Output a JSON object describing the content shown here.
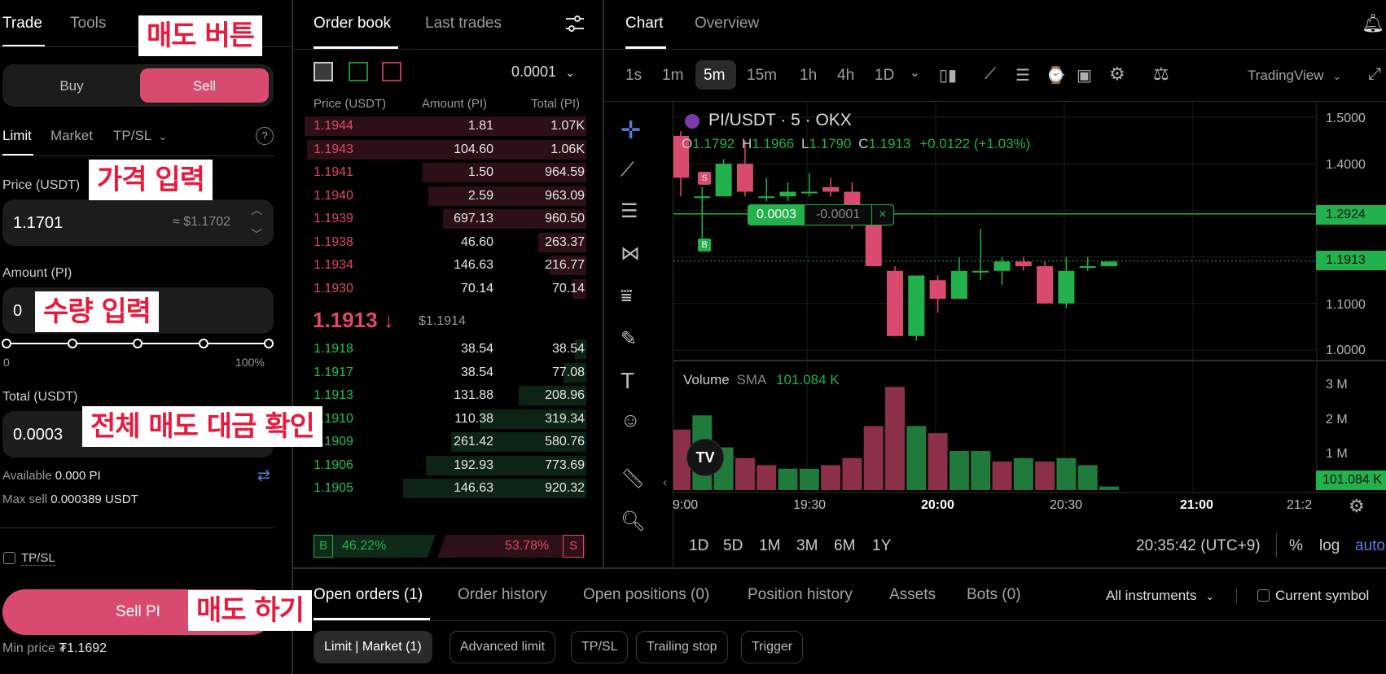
{
  "left": {
    "tabs": [
      "Trade",
      "Tools"
    ],
    "buy": "Buy",
    "sell": "Sell",
    "order_types": [
      "Limit",
      "Market",
      "TP/SL"
    ],
    "price_label": "Price (USDT)",
    "price_value": "1.1701",
    "price_approx": "≈ $1.1702",
    "amount_label": "Amount (PI)",
    "amount_value": "0",
    "slider_min": "0",
    "slider_max": "100%",
    "slider_level": 0,
    "total_label": "Total (USDT)",
    "total_value": "0.0003",
    "available_label": "Available",
    "available_value": "0.000 PI",
    "maxsell_label": "Max sell",
    "maxsell_value": "0.000389 USDT",
    "tpsl": "TP/SL",
    "sell_button": "Sell PI",
    "min_price_label": "Min price",
    "min_price_value": "₮1.1692"
  },
  "annotations": {
    "sell_button": "매도 버튼",
    "price_input": "가격 입력",
    "amount_input": "수량 입력",
    "total_check": "전체 매도 대금 확인",
    "sell_action": "매도 하기"
  },
  "orderbook": {
    "tabs": [
      "Order book",
      "Last trades"
    ],
    "precision": "0.0001",
    "headers": [
      "Price (USDT)",
      "Amount (PI)",
      "Total (PI)"
    ],
    "asks": [
      {
        "price": "1.1944",
        "amount": "1.81",
        "total": "1.07K",
        "depth": 1.0
      },
      {
        "price": "1.1943",
        "amount": "104.60",
        "total": "1.06K",
        "depth": 0.99
      },
      {
        "price": "1.1941",
        "amount": "1.50",
        "total": "964.59",
        "depth": 0.58
      },
      {
        "price": "1.1940",
        "amount": "2.59",
        "total": "963.09",
        "depth": 0.56
      },
      {
        "price": "1.1939",
        "amount": "697.13",
        "total": "960.50",
        "depth": 0.51
      },
      {
        "price": "1.1938",
        "amount": "46.60",
        "total": "263.37",
        "depth": 0.17
      },
      {
        "price": "1.1934",
        "amount": "146.63",
        "total": "216.77",
        "depth": 0.13
      },
      {
        "price": "1.1930",
        "amount": "70.14",
        "total": "70.14",
        "depth": 0.05
      }
    ],
    "last_price": "1.1913 ↓",
    "last_usd": "$1.1914",
    "bids": [
      {
        "price": "1.1918",
        "amount": "38.54",
        "total": "38.54",
        "depth": 0.04
      },
      {
        "price": "1.1917",
        "amount": "38.54",
        "total": "77.08",
        "depth": 0.08
      },
      {
        "price": "1.1913",
        "amount": "131.88",
        "total": "208.96",
        "depth": 0.24
      },
      {
        "price": "1.1910",
        "amount": "110.38",
        "total": "319.34",
        "depth": 0.38
      },
      {
        "price": "1.1909",
        "amount": "261.42",
        "total": "580.76",
        "depth": 0.48
      },
      {
        "price": "1.1906",
        "amount": "192.93",
        "total": "773.69",
        "depth": 0.57
      },
      {
        "price": "1.1905",
        "amount": "146.63",
        "total": "920.32",
        "depth": 0.65
      }
    ],
    "buy_pct": "46.22%",
    "sell_pct": "53.78%",
    "b": "B",
    "s": "S"
  },
  "chart": {
    "tabs": [
      "Chart",
      "Overview"
    ],
    "timeframes": [
      "1s",
      "1m",
      "5m",
      "15m",
      "1h",
      "4h",
      "1D"
    ],
    "active_timeframe": "5m",
    "provider": "TradingView",
    "symbol": "PI/USDT · 5 · OKX",
    "ohlc": {
      "o_label": "O",
      "o": "1.1792",
      "h_label": "H",
      "h": "1.1966",
      "l_label": "L",
      "l": "1.1790",
      "c_label": "C",
      "c": "1.1913",
      "chg": "+0.0122 (+1.03%)"
    },
    "order_line": {
      "qty": "0.0003",
      "pnl": "-0.0001",
      "close": "×"
    },
    "order_line_price": "1.2924",
    "current_price": "1.1913",
    "price_axis": [
      "1.5000",
      "1.4000",
      "1.1000",
      "1.0000"
    ],
    "volume_label": "Volume",
    "sma_label": "SMA",
    "sma_value": "101.084 K",
    "volume_axis": [
      "3 M",
      "2 M",
      "1 M"
    ],
    "volume_current": "101.084 K",
    "time_axis": [
      "9:00",
      "19:30",
      "20:00",
      "20:30",
      "21:00",
      "21:2"
    ],
    "ranges": [
      "1D",
      "5D",
      "1M",
      "3M",
      "6M",
      "1Y"
    ],
    "clock": "20:35:42 (UTC+9)",
    "pct": "%",
    "log": "log",
    "auto": "auto",
    "markers": [
      "S",
      "B"
    ],
    "candles": [
      {
        "o": 1.46,
        "h": 1.47,
        "l": 1.33,
        "c": 1.37
      },
      {
        "o": 1.33,
        "h": 1.35,
        "l": 1.24,
        "c": 1.33
      },
      {
        "o": 1.33,
        "h": 1.41,
        "l": 1.33,
        "c": 1.4
      },
      {
        "o": 1.4,
        "h": 1.45,
        "l": 1.33,
        "c": 1.34
      },
      {
        "o": 1.33,
        "h": 1.37,
        "l": 1.32,
        "c": 1.33
      },
      {
        "o": 1.33,
        "h": 1.36,
        "l": 1.32,
        "c": 1.34
      },
      {
        "o": 1.34,
        "h": 1.38,
        "l": 1.33,
        "c": 1.34
      },
      {
        "o": 1.35,
        "h": 1.37,
        "l": 1.33,
        "c": 1.34
      },
      {
        "o": 1.34,
        "h": 1.36,
        "l": 1.26,
        "c": 1.27
      },
      {
        "o": 1.27,
        "h": 1.28,
        "l": 1.18,
        "c": 1.18
      },
      {
        "o": 1.17,
        "h": 1.18,
        "l": 1.03,
        "c": 1.03
      },
      {
        "o": 1.03,
        "h": 1.16,
        "l": 1.02,
        "c": 1.16
      },
      {
        "o": 1.15,
        "h": 1.16,
        "l": 1.08,
        "c": 1.11
      },
      {
        "o": 1.11,
        "h": 1.2,
        "l": 1.11,
        "c": 1.17
      },
      {
        "o": 1.17,
        "h": 1.26,
        "l": 1.15,
        "c": 1.17
      },
      {
        "o": 1.17,
        "h": 1.2,
        "l": 1.14,
        "c": 1.19
      },
      {
        "o": 1.19,
        "h": 1.2,
        "l": 1.17,
        "c": 1.18
      },
      {
        "o": 1.18,
        "h": 1.19,
        "l": 1.1,
        "c": 1.1
      },
      {
        "o": 1.1,
        "h": 1.2,
        "l": 1.09,
        "c": 1.17
      },
      {
        "o": 1.18,
        "h": 1.2,
        "l": 1.17,
        "c": 1.18
      },
      {
        "o": 1.18,
        "h": 1.19,
        "l": 1.18,
        "c": 1.19
      }
    ],
    "volumes": [
      1.7,
      2.1,
      1.2,
      0.9,
      0.7,
      0.6,
      0.6,
      0.7,
      0.9,
      1.8,
      2.9,
      1.8,
      1.6,
      1.1,
      1.1,
      0.8,
      0.9,
      0.8,
      0.9,
      0.7,
      0.1
    ],
    "volume_up": [
      false,
      true,
      true,
      false,
      false,
      true,
      true,
      false,
      false,
      false,
      false,
      true,
      false,
      true,
      true,
      false,
      true,
      false,
      true,
      true,
      true
    ]
  },
  "bottom": {
    "tabs": [
      "Open orders (1)",
      "Order history",
      "Open positions (0)",
      "Position history",
      "Assets",
      "Bots (0)"
    ],
    "instruments": "All instruments",
    "current_symbol": "Current symbol",
    "subtabs": [
      "Limit | Market (1)",
      "Advanced limit",
      "TP/SL",
      "Trailing stop",
      "Trigger"
    ]
  },
  "colors": {
    "sell": "#d94a6f",
    "buy": "#22b14c",
    "ask_text": "#e0476a",
    "bid_text": "#20c05a",
    "link": "#5a7bd8"
  },
  "icons": [
    "bell-plus-icon",
    "settings-sliders-icon",
    "chevron-down-icon",
    "help-icon",
    "swap-icon",
    "crosshair-icon",
    "trendline-icon",
    "fib-icon",
    "pattern-icon",
    "forecast-icon",
    "brush-icon",
    "text-icon",
    "emoji-icon",
    "ruler-icon",
    "zoom-icon",
    "candles-icon",
    "indicators-icon",
    "templates-icon",
    "replay-icon",
    "gear-icon",
    "scale-icon",
    "fullscreen-icon",
    "tv-logo-icon"
  ]
}
